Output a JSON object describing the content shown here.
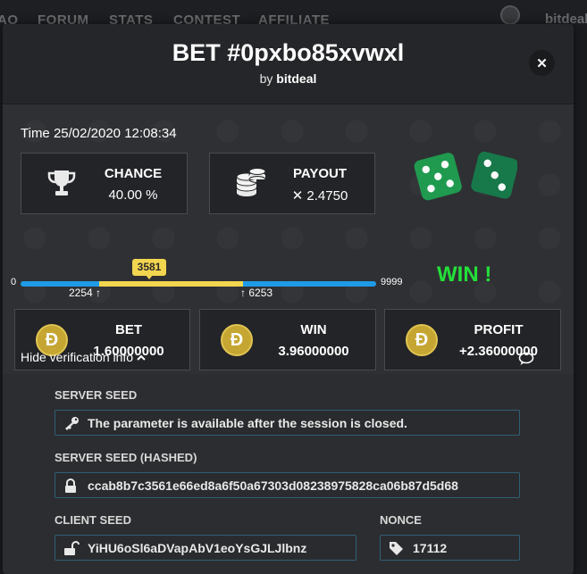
{
  "background_nav": {
    "items": [
      "AO",
      "FORUM",
      "STATS",
      "CONTEST",
      "AFFILIATE"
    ],
    "user": "bitdeal"
  },
  "modal": {
    "title": "BET #0pxbo85xvwxl",
    "by_prefix": "by",
    "username": "bitdeal",
    "close_label": "✕"
  },
  "bet": {
    "time_label": "Time",
    "time_value": "25/02/2020 12:08:34",
    "chance_label": "CHANCE",
    "chance_value": "40.00 %",
    "payout_label": "PAYOUT",
    "payout_value": "✕ 2.4750",
    "result_text": "WIN !"
  },
  "range": {
    "min": "0",
    "max": "9999",
    "roll": "3581",
    "low": "2254",
    "high": "6253",
    "min_value": 0,
    "max_value": 9999,
    "roll_value": 3581,
    "low_value": 2254,
    "high_value": 6253
  },
  "amounts": [
    {
      "label": "BET",
      "value": "1.60000000",
      "currency_symbol": "Ð"
    },
    {
      "label": "WIN",
      "value": "3.96000000",
      "currency_symbol": "Ð"
    },
    {
      "label": "PROFIT",
      "value": "+2.36000000",
      "currency_symbol": "Ð"
    }
  ],
  "verification": {
    "toggle_label": "Hide verification info",
    "server_seed_label": "SERVER SEED",
    "server_seed_value": "The parameter is available after the session is closed.",
    "server_seed_hashed_label": "SERVER SEED (HASHED)",
    "server_seed_hashed_value": "ccab8b7c3561e66ed8a6f50a67303d08238975828ca06b87d5d68",
    "client_seed_label": "CLIENT SEED",
    "client_seed_value": "YiHU6oSl6aDVapAbV1eoYsGJLJlbnz",
    "nonce_label": "NONCE",
    "nonce_value": "17112"
  },
  "colors": {
    "win_green": "#23e03a",
    "range_blue": "#1e9be7",
    "range_yellow": "#f3d64f",
    "dice_green": "#1f8a4a",
    "doge_gold": "#c5a632"
  },
  "icons": [
    "trophy-icon",
    "coins-icon",
    "dice-icon",
    "doge-coin-icon",
    "chevron-up-icon",
    "chat-icon",
    "key-icon",
    "lock-icon",
    "unlock-icon",
    "tag-icon",
    "close-icon"
  ]
}
